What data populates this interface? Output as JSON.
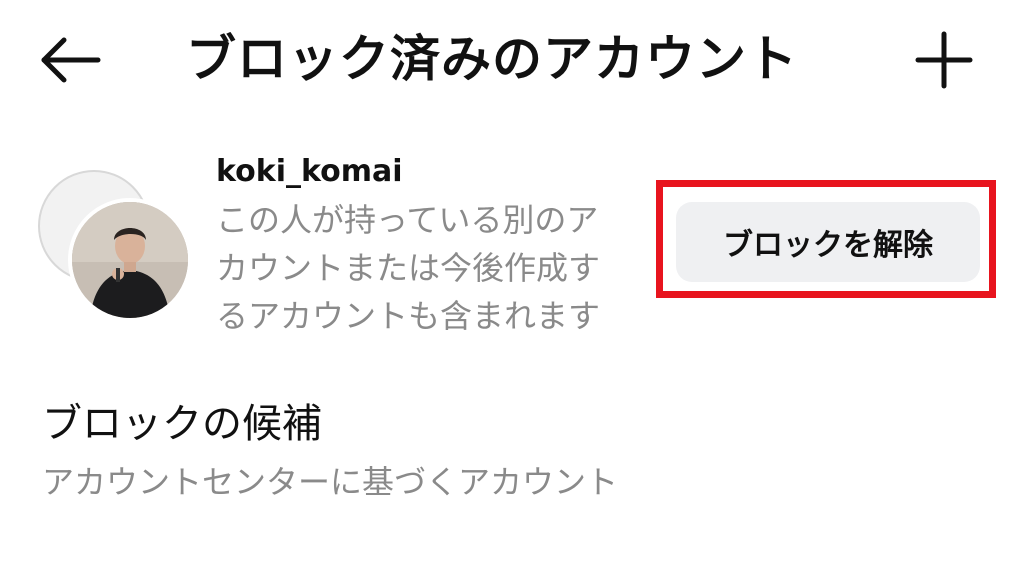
{
  "header": {
    "back_icon": "arrow-left-icon",
    "title": "ブロック済みのアカウント",
    "add_icon": "plus-icon"
  },
  "blocked_account": {
    "username": "koki_komai",
    "description_lines": [
      "この人が持っている別のア",
      "カウントまたは今後作成す",
      "るアカウントも含まれます"
    ],
    "unblock_label": "ブロックを解除"
  },
  "suggestions": {
    "title": "ブロックの候補",
    "subtitle": "アカウントセンターに基づくアカウント"
  },
  "colors": {
    "highlight": "#e8141e",
    "secondary_text": "#8a8a8a",
    "button_bg": "#eff0f2"
  }
}
